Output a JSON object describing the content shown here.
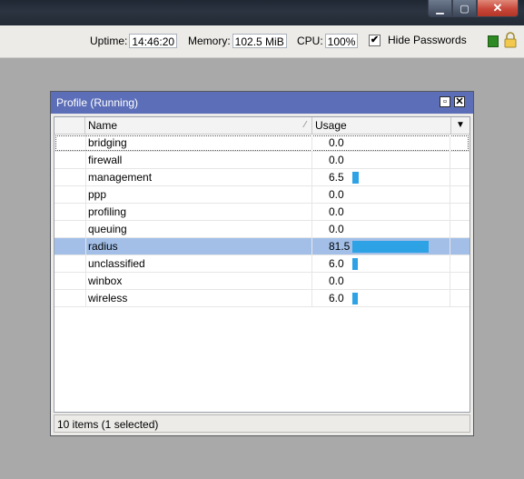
{
  "window_controls": {
    "minimize": "▁",
    "maximize": "▢",
    "close": "✕"
  },
  "status": {
    "uptime_label": "Uptime:",
    "uptime_value": "14:46:20",
    "memory_label": "Memory:",
    "memory_value": "102.5 MiB",
    "cpu_label": "CPU:",
    "cpu_value": "100%",
    "hide_passwords_label": "Hide Passwords",
    "hide_passwords_checked": "✔"
  },
  "profile_window": {
    "title": "Profile (Running)",
    "columns": {
      "name": "Name",
      "usage": "Usage"
    },
    "rows": [
      {
        "name": "bridging",
        "usage": "0.0"
      },
      {
        "name": "firewall",
        "usage": "0.0"
      },
      {
        "name": "management",
        "usage": "6.5"
      },
      {
        "name": "ppp",
        "usage": "0.0"
      },
      {
        "name": "profiling",
        "usage": "0.0"
      },
      {
        "name": "queuing",
        "usage": "0.0"
      },
      {
        "name": "radius",
        "usage": "81.5"
      },
      {
        "name": "unclassified",
        "usage": "6.0"
      },
      {
        "name": "winbox",
        "usage": "0.0"
      },
      {
        "name": "wireless",
        "usage": "6.0"
      }
    ],
    "selected_row": "radius",
    "footer": "10 items (1 selected)"
  },
  "colors": {
    "usage_bar": "#2da3e6",
    "selection": "#a3bfe8",
    "window_title": "#5c6eb8"
  },
  "icons": [
    "lock-icon",
    "sort-icon",
    "dropdown-icon",
    "restore-icon",
    "close-icon"
  ]
}
